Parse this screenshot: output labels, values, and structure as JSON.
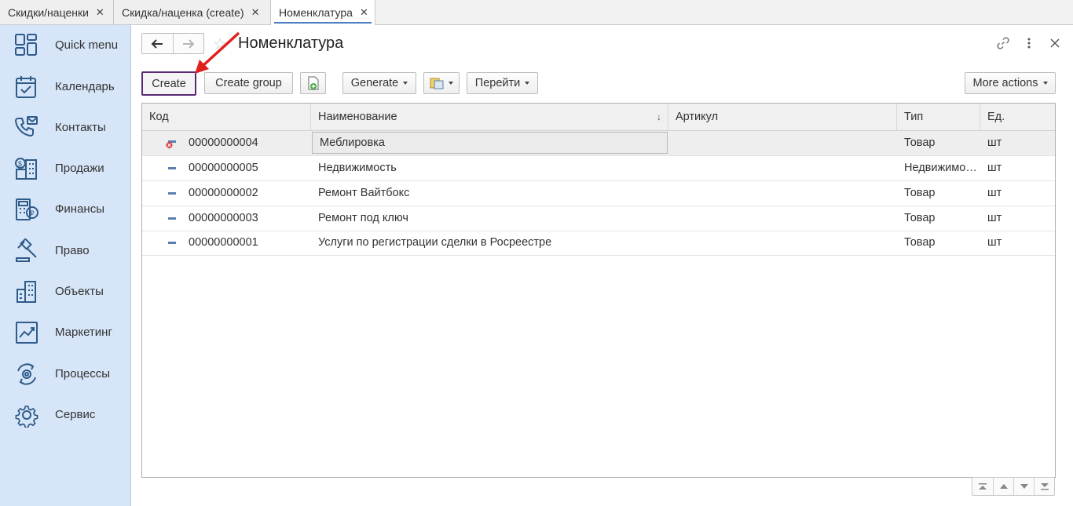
{
  "tabs": [
    {
      "label": "Скидки/наценки",
      "close": "✕"
    },
    {
      "label": "Скидка/наценка (create)",
      "close": "✕"
    },
    {
      "label": "Номенклатура",
      "close": "✕"
    }
  ],
  "sidebar": {
    "items": [
      {
        "label": "Quick menu",
        "icon": "quick-menu-icon"
      },
      {
        "label": "Календарь",
        "icon": "calendar-icon"
      },
      {
        "label": "Контакты",
        "icon": "contacts-icon"
      },
      {
        "label": "Продажи",
        "icon": "sales-icon"
      },
      {
        "label": "Финансы",
        "icon": "finance-icon"
      },
      {
        "label": "Право",
        "icon": "law-icon"
      },
      {
        "label": "Объекты",
        "icon": "buildings-icon"
      },
      {
        "label": "Маркетинг",
        "icon": "marketing-icon"
      },
      {
        "label": "Процессы",
        "icon": "processes-icon"
      },
      {
        "label": "Сервис",
        "icon": "gear-icon"
      }
    ]
  },
  "header": {
    "title": "Номенклатура"
  },
  "toolbar": {
    "create": "Create",
    "create_group": "Create group",
    "generate": "Generate",
    "goto": "Перейти",
    "more_actions": "More actions"
  },
  "table": {
    "columns": [
      "Код",
      "Наименование",
      "Артикул",
      "Тип",
      "Ед."
    ],
    "sort_indicator": "↓",
    "rows": [
      {
        "code": "00000000004",
        "name": "Меблировка",
        "article": "",
        "type": "Товар",
        "unit": "шт",
        "marked_deleted": true
      },
      {
        "code": "00000000005",
        "name": "Недвижимость",
        "article": "",
        "type": "Недвижимость",
        "unit": "шт",
        "marked_deleted": false
      },
      {
        "code": "00000000002",
        "name": "Ремонт Вайтбокс",
        "article": "",
        "type": "Товар",
        "unit": "шт",
        "marked_deleted": false
      },
      {
        "code": "00000000003",
        "name": "Ремонт под ключ",
        "article": "",
        "type": "Товар",
        "unit": "шт",
        "marked_deleted": false
      },
      {
        "code": "00000000001",
        "name": "Услуги по регистрации сделки в Росреестре",
        "article": "",
        "type": "Товар",
        "unit": "шт",
        "marked_deleted": false
      }
    ]
  },
  "colors": {
    "sidebar_bg": "#d6e5f7",
    "icon_blue": "#2f5b8a",
    "create_outline": "#5b2a74",
    "arrow_red": "#e0201c"
  }
}
